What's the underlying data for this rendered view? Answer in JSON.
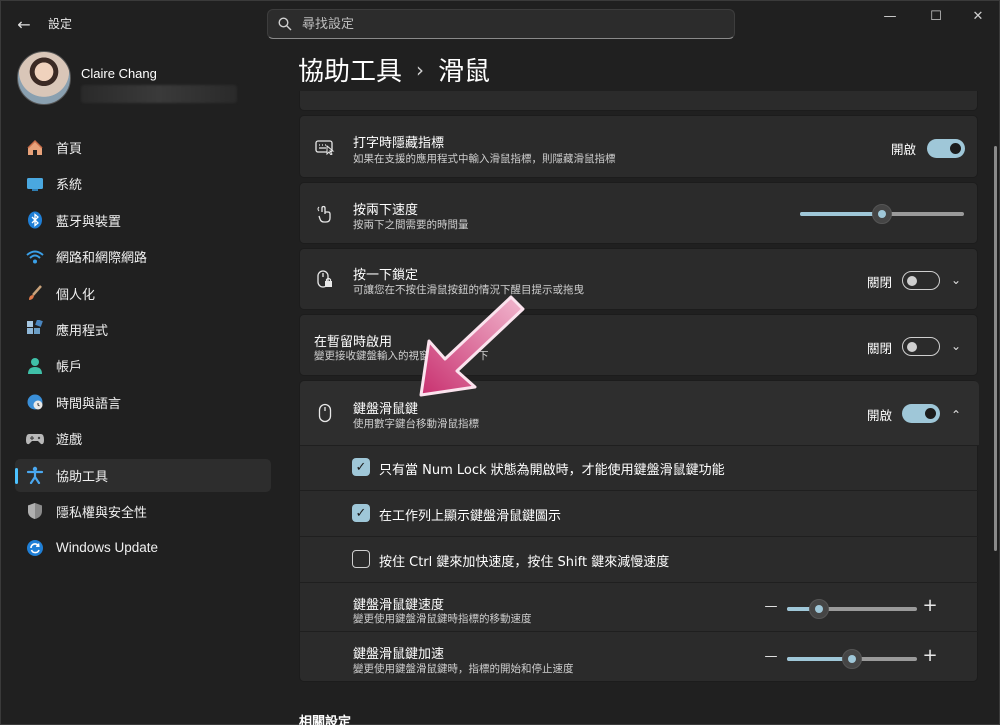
{
  "window": {
    "app_title": "設定",
    "search_placeholder": "尋找設定",
    "controls": [
      "—",
      "☐",
      "✕"
    ]
  },
  "profile": {
    "name": "Claire Chang"
  },
  "sidebar": {
    "items": [
      {
        "label": "首頁",
        "icon": "home-icon",
        "active": false
      },
      {
        "label": "系統",
        "icon": "system-icon",
        "active": false
      },
      {
        "label": "藍牙與裝置",
        "icon": "bluetooth-icon",
        "active": false
      },
      {
        "label": "網路和網際網路",
        "icon": "wifi-icon",
        "active": false
      },
      {
        "label": "個人化",
        "icon": "brush-icon",
        "active": false
      },
      {
        "label": "應用程式",
        "icon": "apps-icon",
        "active": false
      },
      {
        "label": "帳戶",
        "icon": "account-icon",
        "active": false
      },
      {
        "label": "時間與語言",
        "icon": "clock-globe-icon",
        "active": false
      },
      {
        "label": "遊戲",
        "icon": "gamepad-icon",
        "active": false
      },
      {
        "label": "協助工具",
        "icon": "accessibility-icon",
        "active": true
      },
      {
        "label": "隱私權與安全性",
        "icon": "shield-icon",
        "active": false
      },
      {
        "label": "Windows Update",
        "icon": "update-icon",
        "active": false
      }
    ]
  },
  "breadcrumb": {
    "parent": "協助工具",
    "separator": "›",
    "current": "滑鼠"
  },
  "settings": {
    "hide_pointer": {
      "title": "打字時隱藏指標",
      "desc": "如果在支援的應用程式中輸入滑鼠指標，則隱藏滑鼠指標",
      "state": "開啟",
      "on": true
    },
    "double_click": {
      "title": "按兩下速度",
      "desc": "按兩下之間需要的時間量",
      "value": 0.5
    },
    "click_lock": {
      "title": "按一下鎖定",
      "desc": "可讓您在不按住滑鼠按鈕的情況下醒目提示或拖曳",
      "state": "關閉",
      "on": false
    },
    "hover_activate": {
      "title": "在暫留時啟用",
      "desc": "變更接收鍵盤輸入的視窗",
      "desc_tail": "下",
      "state": "關閉",
      "on": false
    },
    "mouse_keys": {
      "title": "鍵盤滑鼠鍵",
      "desc": "使用數字鍵台移動滑鼠指標",
      "state": "開啟",
      "on": true,
      "options": [
        {
          "label": "只有當 Num Lock 狀態為開啟時，才能使用鍵盤滑鼠鍵功能",
          "checked": true
        },
        {
          "label": "在工作列上顯示鍵盤滑鼠鍵圖示",
          "checked": true
        },
        {
          "label": "按住 Ctrl 鍵來加快速度，按住 Shift 鍵來減慢速度",
          "checked": false
        }
      ],
      "speed": {
        "title": "鍵盤滑鼠鍵速度",
        "desc": "變更使用鍵盤滑鼠鍵時指標的移動速度",
        "value": 0.25,
        "minus": "—",
        "plus": "+"
      },
      "accel": {
        "title": "鍵盤滑鼠鍵加速",
        "desc": "變更使用鍵盤滑鼠鍵時，指標的開始和停止速度",
        "value": 0.5,
        "minus": "—",
        "plus": "+"
      }
    }
  },
  "related": {
    "heading": "相關設定"
  },
  "colors": {
    "accent": "#9fc7d8",
    "active_indicator": "#4cc2ff",
    "annotation_arrow": "#d24a86"
  }
}
